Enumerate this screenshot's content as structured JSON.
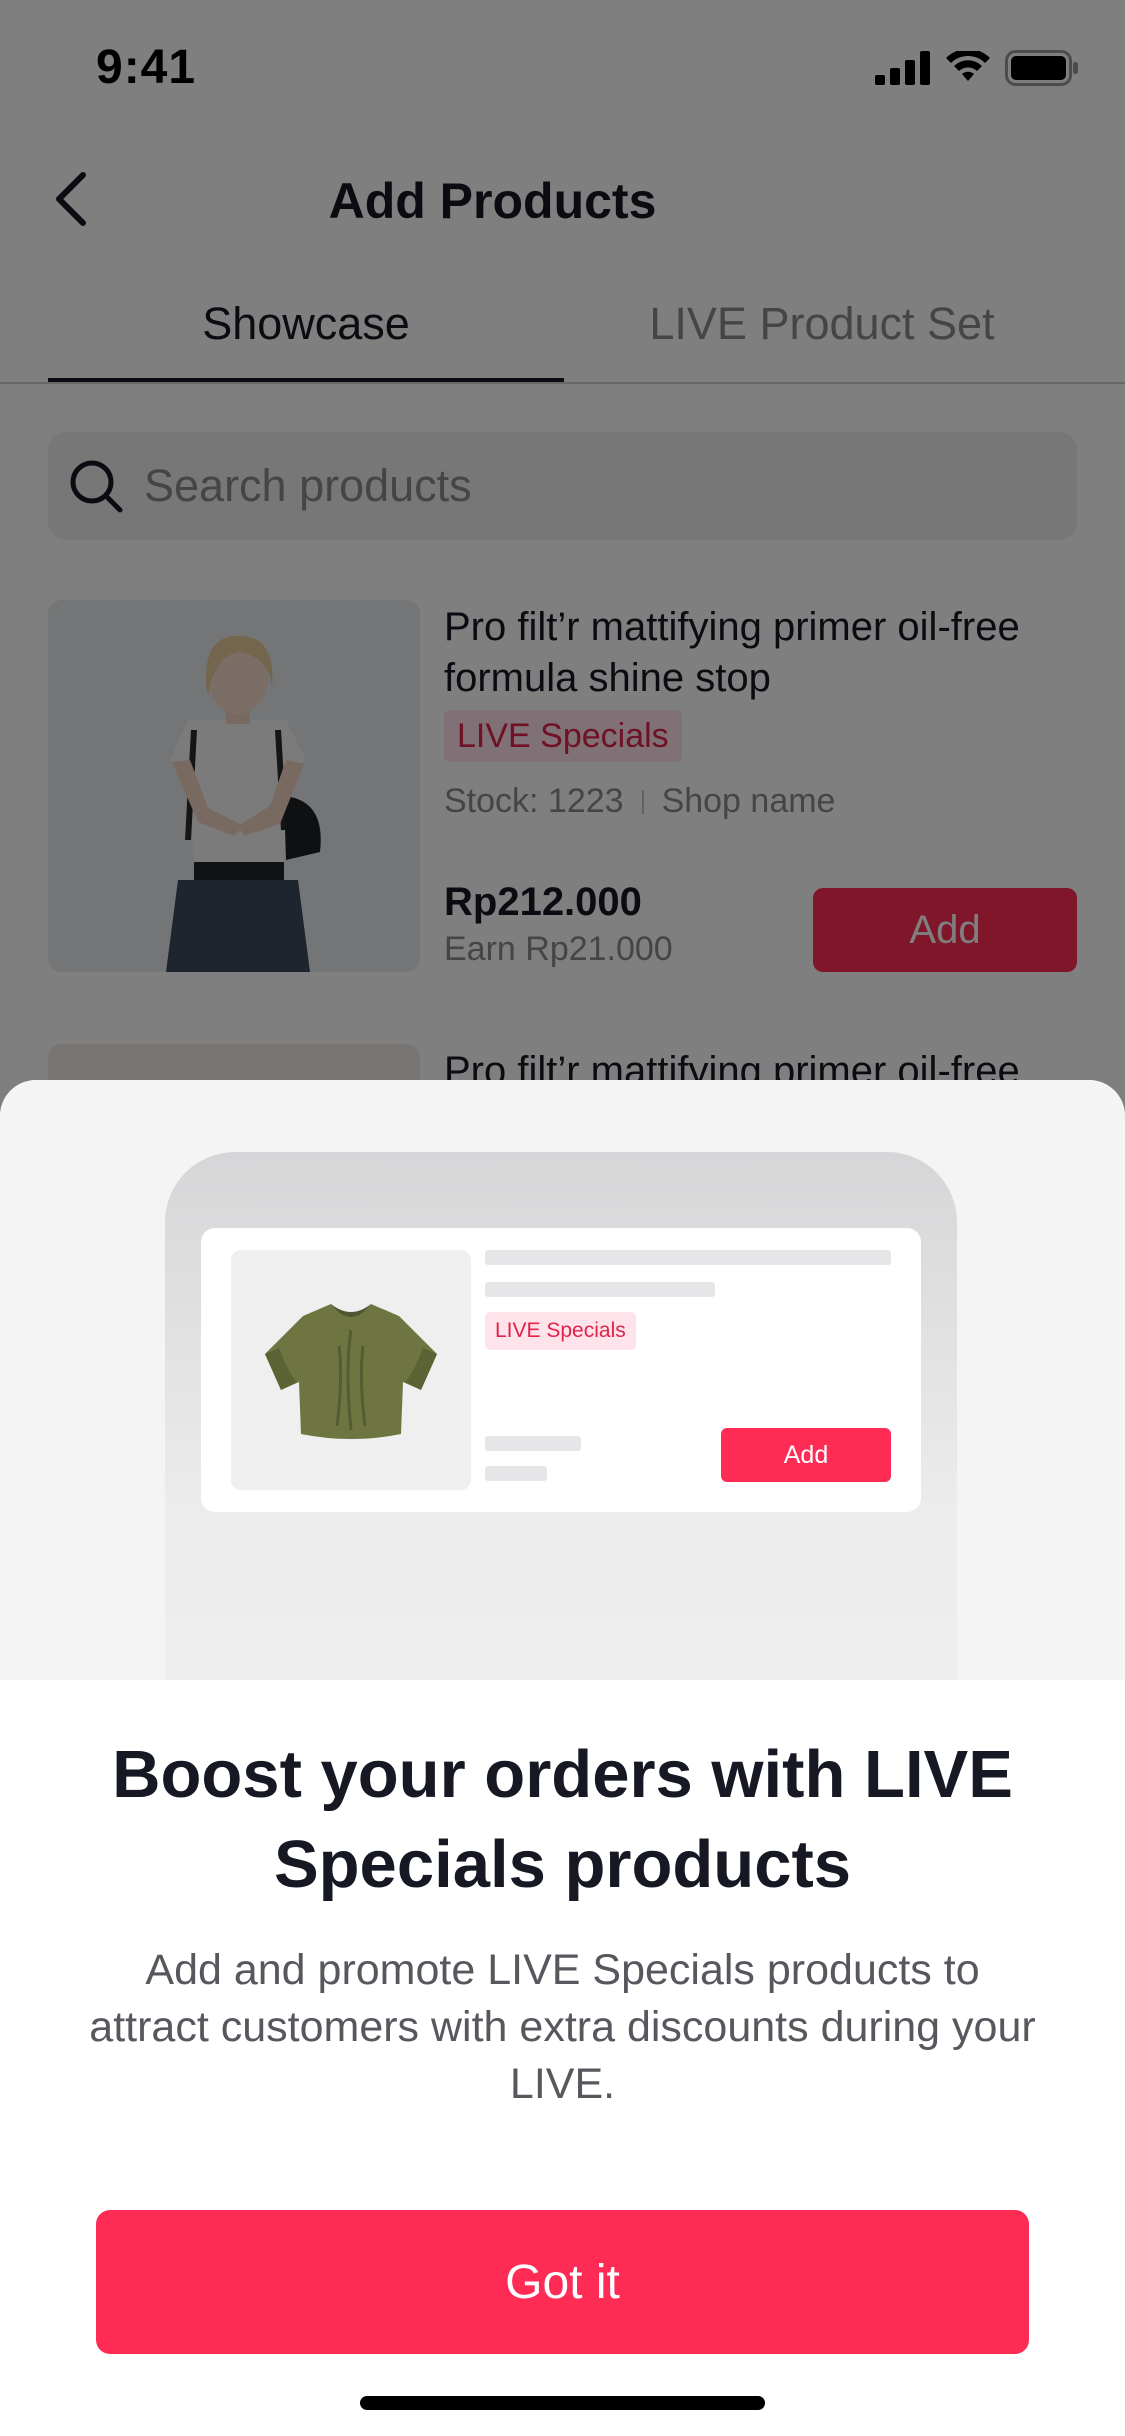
{
  "status_bar": {
    "time": "9:41"
  },
  "header": {
    "title": "Add Products"
  },
  "tabs": [
    {
      "label": "Showcase",
      "active": true
    },
    {
      "label": "LIVE Product Set",
      "active": false
    }
  ],
  "search": {
    "placeholder": "Search products"
  },
  "products": [
    {
      "name": "Pro filt’r mattifying primer oil-free formula shine stop",
      "tag": "LIVE Specials",
      "stock": "Stock: 1223",
      "shop": "Shop name",
      "price": "Rp212.000",
      "earn": "Earn Rp21.000",
      "add_label": "Add"
    },
    {
      "name": "Pro filt’r mattifying primer oil-free"
    }
  ],
  "sheet": {
    "illustration": {
      "tag": "LIVE Specials",
      "add_label": "Add"
    },
    "title": "Boost your orders with LIVE Specials products",
    "description": "Add and promote LIVE Specials products to attract customers with extra discounts during your LIVE.",
    "button_label": "Got it"
  },
  "colors": {
    "accent": "#fe2c55",
    "tag_bg": "#ffe3ea",
    "tag_text": "#e0234a",
    "text_primary": "#161823",
    "text_secondary": "#8a8b91"
  }
}
